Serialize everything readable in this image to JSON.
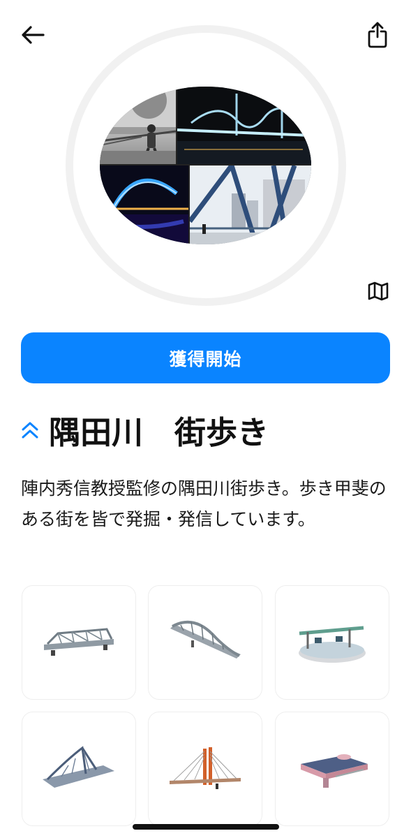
{
  "header": {
    "back_icon": "arrow-left-icon",
    "share_icon": "share-icon",
    "map_icon": "map-icon"
  },
  "hero": {
    "photos": [
      "bridge-walker-monochrome",
      "suspension-bridge-night-lights",
      "arch-bridge-blue-lights",
      "bridge-steel-cables-daytime"
    ]
  },
  "primary_button": {
    "label": "獲得開始"
  },
  "section": {
    "collapse_icon": "chevron-double-up-icon",
    "title": "隅田川　街歩き",
    "description": "陣内秀信教授監修の隅田川街歩き。歩き甲斐のある街を皆で発掘・発信しています。"
  },
  "models": [
    {
      "icon": "truss-bridge-model"
    },
    {
      "icon": "arch-bridge-model"
    },
    {
      "icon": "circular-bridge-platform-model"
    },
    {
      "icon": "suspension-bridge-model"
    },
    {
      "icon": "cable-stayed-bridge-model"
    },
    {
      "icon": "deck-bridge-model"
    }
  ],
  "colors": {
    "accent": "#0a84ff",
    "ring": "#f1f1f1",
    "tile_border": "#eeeeee"
  }
}
